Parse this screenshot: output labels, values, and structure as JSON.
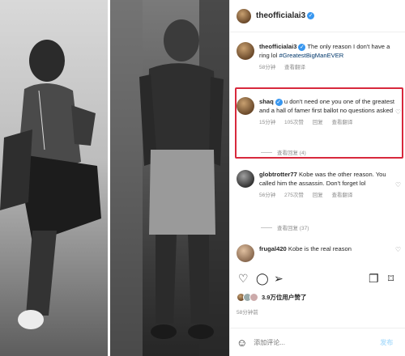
{
  "header": {
    "username": "theofficialai3",
    "verified": true
  },
  "comments": [
    {
      "user": "theofficialai3",
      "verified": true,
      "text": "The only reason I don't have a ring lol ",
      "hashtag": "#GreatestBigManEVER",
      "time": "58分钟",
      "translate": "查看翻译"
    },
    {
      "user": "shaq",
      "verified": true,
      "text": "u don't need one you one of the greatest and a hall of famer first ballot no questions asked",
      "time": "15分钟",
      "likes": "105次赞",
      "reply": "回复",
      "translate": "查看翻译",
      "view_replies": "查看回复 (4)"
    },
    {
      "user": "globtrotter77",
      "verified": false,
      "text": "Kobe was the other reason. You called him the assassin. Don't forget lol",
      "time": "56分钟",
      "likes": "275次赞",
      "reply": "回复",
      "translate": "查看翻译",
      "view_replies": "查看回复 (37)"
    },
    {
      "user": "frugal420",
      "verified": false,
      "text": "Kobe is the real reason"
    }
  ],
  "likes_text": "3.9万位用户赞了",
  "time_ago": "58分钟前",
  "comment_placeholder": "添加评论...",
  "post_label": "发布",
  "colors": {
    "highlight": "#d8293d",
    "link": "#00376b",
    "verified": "#3897f0"
  },
  "icons": [
    "heart-icon",
    "comment-icon",
    "share-icon",
    "copy-icon",
    "bookmark-icon",
    "emoji-icon"
  ]
}
